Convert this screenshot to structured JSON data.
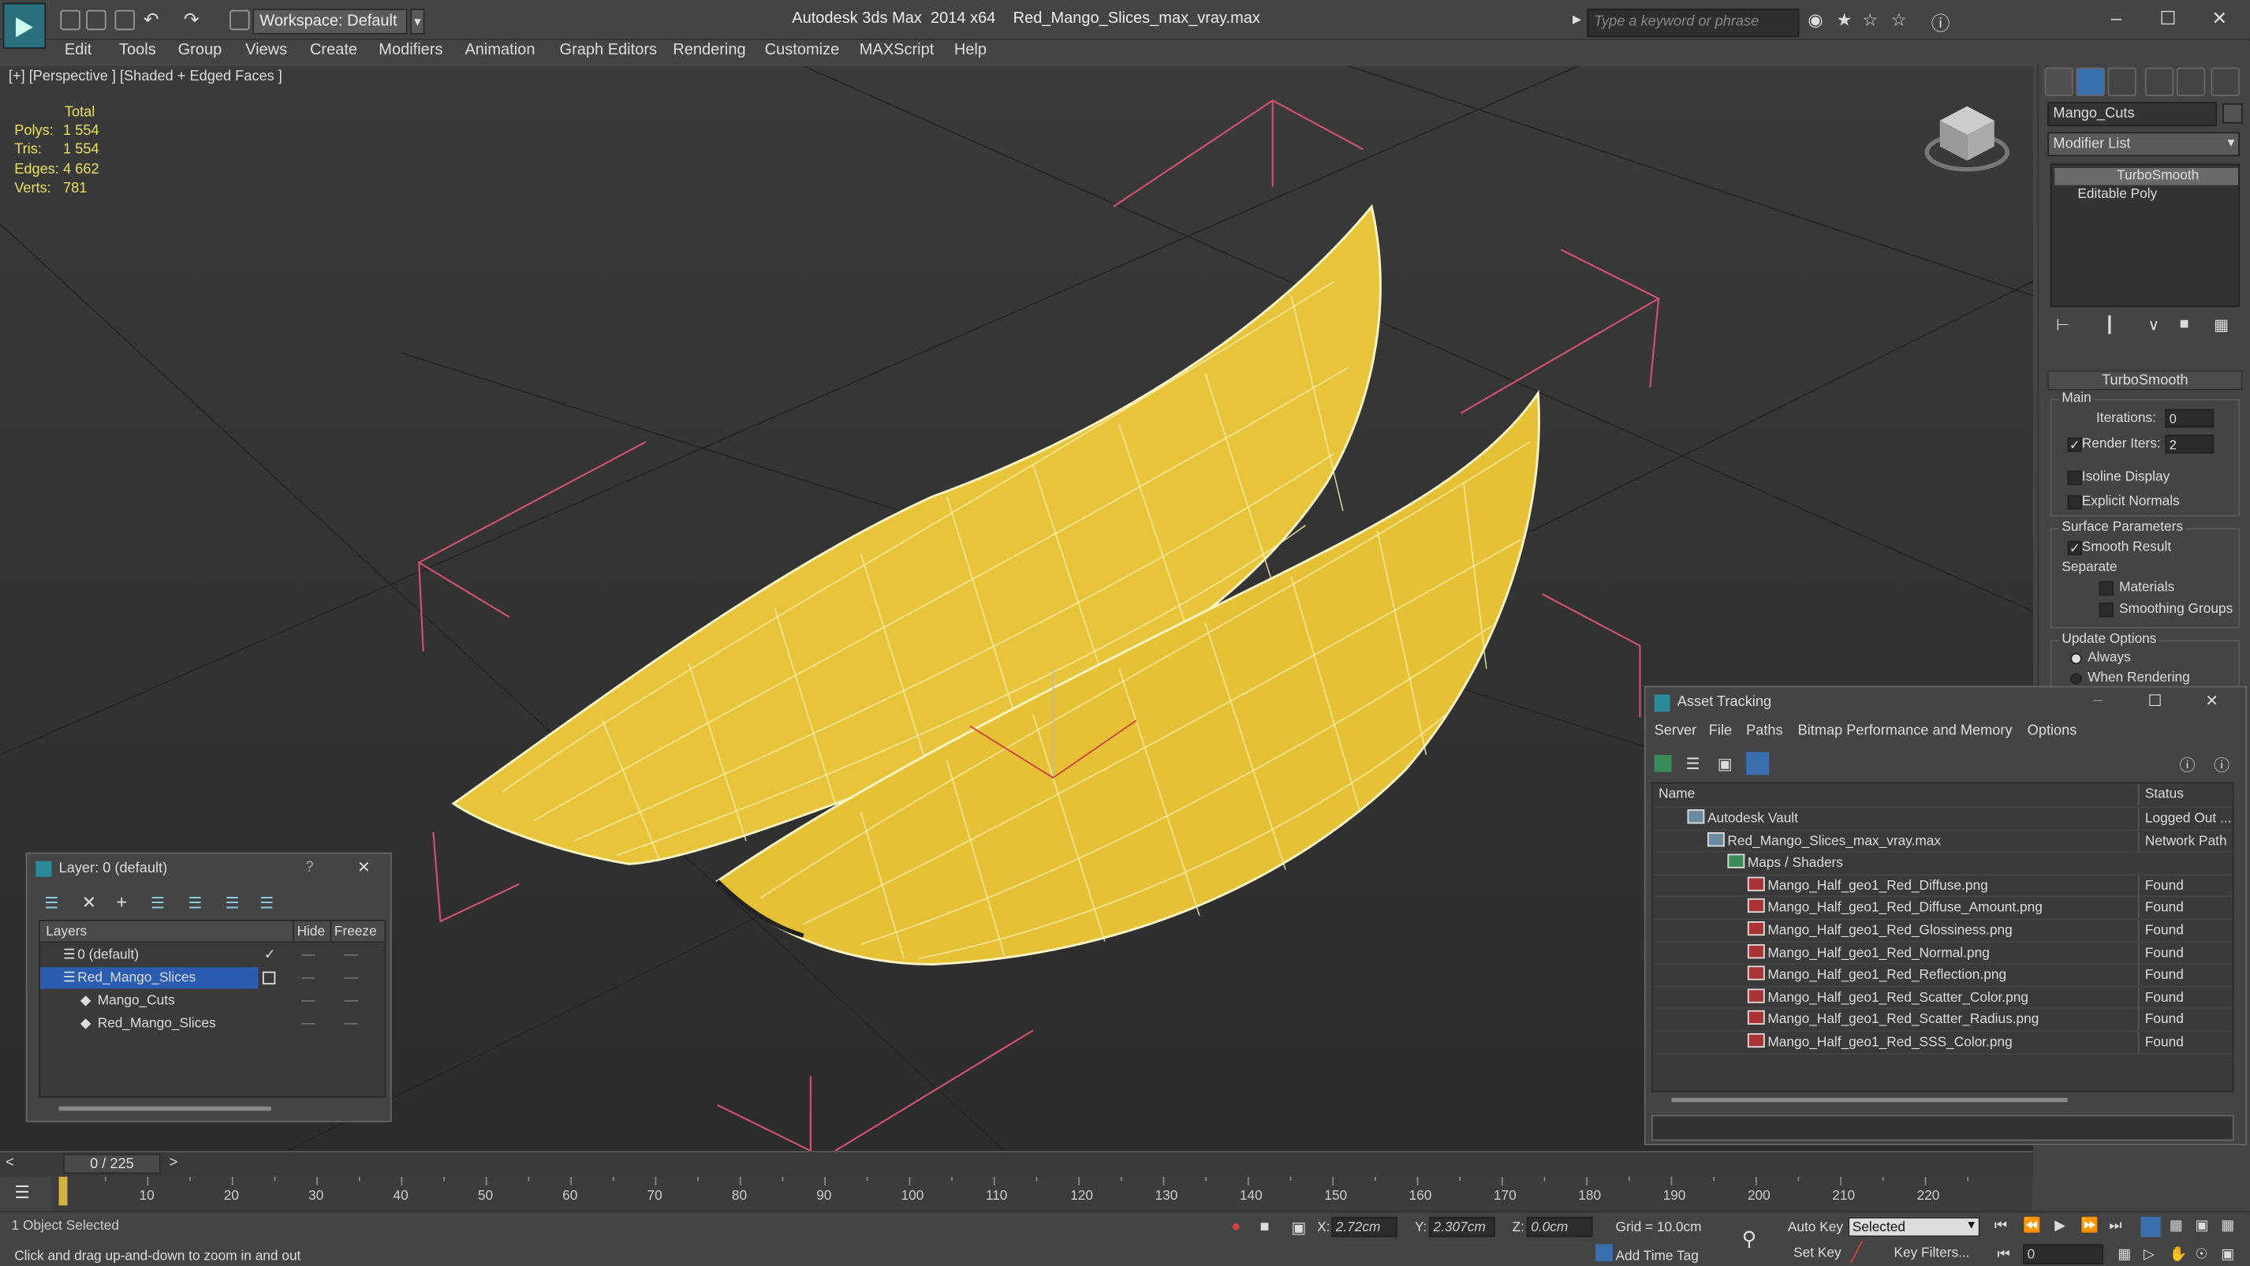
{
  "titlebar": {
    "workspace_label": "Workspace: Default",
    "app_title": "Autodesk 3ds Max  2014 x64",
    "file_title": "Red_Mango_Slices_max_vray.max",
    "search_placeholder": "Type a keyword or phrase"
  },
  "menus": [
    "Edit",
    "Tools",
    "Group",
    "Views",
    "Create",
    "Modifiers",
    "Animation",
    "Graph Editors",
    "Rendering",
    "Customize",
    "MAXScript",
    "Help"
  ],
  "viewport": {
    "label": "[+] [Perspective ] [Shaded + Edged Faces ]",
    "stats": {
      "total_label": "Total",
      "rows": [
        {
          "label": "Polys:",
          "value": "1 554"
        },
        {
          "label": "Tris:",
          "value": "1 554"
        },
        {
          "label": "Edges:",
          "value": "4 662"
        },
        {
          "label": "Verts:",
          "value": "781"
        }
      ]
    }
  },
  "command_panel": {
    "object_name": "Mango_Cuts",
    "modifier_list": "Modifier List",
    "stack": [
      "TurboSmooth",
      "Editable Poly"
    ],
    "rollout_title": "TurboSmooth",
    "main_label": "Main",
    "iterations_label": "Iterations:",
    "iterations_value": "0",
    "render_iters_label": "Render Iters:",
    "render_iters_value": "2",
    "isoline_label": "Isoline Display",
    "explicit_normals_label": "Explicit Normals",
    "surface_params_label": "Surface Parameters",
    "smooth_result_label": "Smooth Result",
    "separate_label": "Separate",
    "materials_label": "Materials",
    "smoothing_groups_label": "Smoothing Groups",
    "update_options_label": "Update Options",
    "always_label": "Always",
    "when_rendering_label": "When Rendering"
  },
  "layer_window": {
    "title": "Layer: 0 (default)",
    "help": "?",
    "col_layers": "Layers",
    "col_hide": "Hide",
    "col_freeze": "Freeze",
    "rows": [
      {
        "name": "0 (default)",
        "indent": 0
      },
      {
        "name": "Red_Mango_Slices",
        "indent": 0
      },
      {
        "name": "Mango_Cuts",
        "indent": 1
      },
      {
        "name": "Red_Mango_Slices",
        "indent": 1
      }
    ]
  },
  "asset_window": {
    "title": "Asset Tracking",
    "menus": [
      "Server",
      "File",
      "Paths",
      "Bitmap Performance and Memory",
      "Options"
    ],
    "col_name": "Name",
    "col_status": "Status",
    "rows": [
      {
        "name": "Autodesk Vault",
        "status": "Logged Out ...",
        "indent": 0
      },
      {
        "name": "Red_Mango_Slices_max_vray.max",
        "status": "Network Path",
        "indent": 1
      },
      {
        "name": "Maps / Shaders",
        "status": "",
        "indent": 2
      },
      {
        "name": "Mango_Half_geo1_Red_Diffuse.png",
        "status": "Found",
        "indent": 3
      },
      {
        "name": "Mango_Half_geo1_Red_Diffuse_Amount.png",
        "status": "Found",
        "indent": 3
      },
      {
        "name": "Mango_Half_geo1_Red_Glossiness.png",
        "status": "Found",
        "indent": 3
      },
      {
        "name": "Mango_Half_geo1_Red_Normal.png",
        "status": "Found",
        "indent": 3
      },
      {
        "name": "Mango_Half_geo1_Red_Reflection.png",
        "status": "Found",
        "indent": 3
      },
      {
        "name": "Mango_Half_geo1_Red_Scatter_Color.png",
        "status": "Found",
        "indent": 3
      },
      {
        "name": "Mango_Half_geo1_Red_Scatter_Radius.png",
        "status": "Found",
        "indent": 3
      },
      {
        "name": "Mango_Half_geo1_Red_SSS_Color.png",
        "status": "Found",
        "indent": 3
      }
    ]
  },
  "timeline": {
    "frame_display": "0 / 225",
    "ticks": [
      "10",
      "20",
      "30",
      "40",
      "50",
      "60",
      "70",
      "80",
      "90",
      "100",
      "110",
      "120",
      "130",
      "140",
      "150",
      "160",
      "170",
      "180",
      "190",
      "200",
      "210",
      "220"
    ]
  },
  "status": {
    "selection": "1 Object Selected",
    "prompt": "Click and drag up-and-down to zoom in and out",
    "x_label": "X:",
    "x_value": "2.72cm",
    "y_label": "Y:",
    "y_value": "2.307cm",
    "z_label": "Z:",
    "z_value": "0.0cm",
    "grid": "Grid = 10.0cm",
    "auto_key": "Auto Key",
    "selected_dropdown": "Selected",
    "set_key": "Set Key",
    "key_filters": "Key Filters...",
    "add_time_tag": "Add Time Tag",
    "frame_value": "0"
  },
  "colors": {
    "mango": "#e8c43a",
    "stat_yellow": "#e9e060",
    "selection_blue": "#2a5db0",
    "gizmo_pink": "#d05070"
  }
}
